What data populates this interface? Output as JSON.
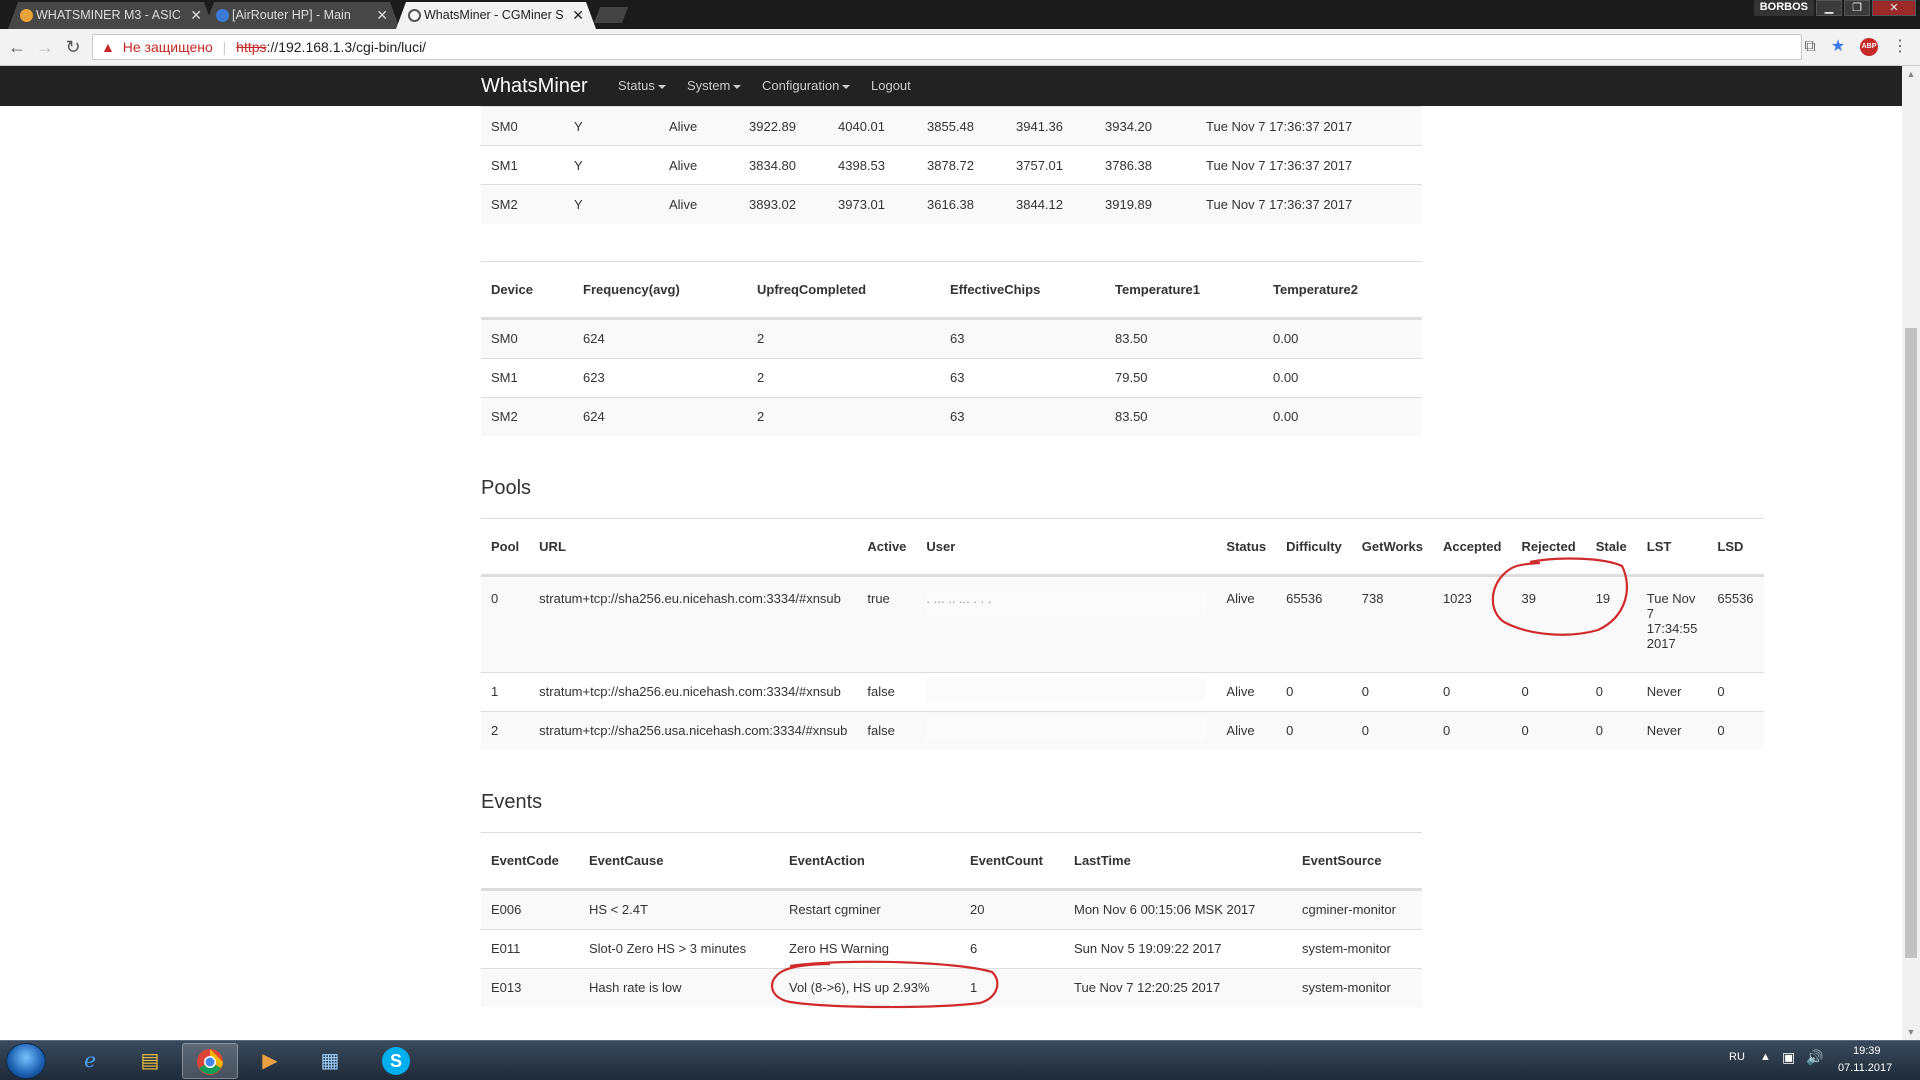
{
  "browser": {
    "tabs": [
      {
        "title": "WHATSMINER M3 - ASIC"
      },
      {
        "title": "[AirRouter HP] - Main"
      },
      {
        "title": "WhatsMiner - CGMiner S"
      }
    ],
    "profile_name": "BORBOS",
    "address": {
      "security_label": "Не защищено",
      "scheme": "https",
      "rest": "://192.168.1.3/cgi-bin/luci/"
    },
    "extension_abp": "ABP"
  },
  "site": {
    "brand": "WhatsMiner",
    "menu": {
      "status": "Status",
      "system": "System",
      "configuration": "Configuration",
      "logout": "Logout"
    }
  },
  "devices_table": {
    "rows": [
      [
        "SM0",
        "Y",
        "Alive",
        "3922.89",
        "4040.01",
        "3855.48",
        "3941.36",
        "3934.20",
        "Tue Nov 7 17:36:37 2017"
      ],
      [
        "SM1",
        "Y",
        "Alive",
        "3834.80",
        "4398.53",
        "3878.72",
        "3757.01",
        "3786.38",
        "Tue Nov 7 17:36:37 2017"
      ],
      [
        "SM2",
        "Y",
        "Alive",
        "3893.02",
        "3973.01",
        "3616.38",
        "3844.12",
        "3919.89",
        "Tue Nov 7 17:36:37 2017"
      ]
    ]
  },
  "freq_table": {
    "headers": [
      "Device",
      "Frequency(avg)",
      "UpfreqCompleted",
      "EffectiveChips",
      "Temperature1",
      "Temperature2"
    ],
    "rows": [
      [
        "SM0",
        "624",
        "2",
        "63",
        "83.50",
        "0.00"
      ],
      [
        "SM1",
        "623",
        "2",
        "63",
        "79.50",
        "0.00"
      ],
      [
        "SM2",
        "624",
        "2",
        "63",
        "83.50",
        "0.00"
      ]
    ]
  },
  "pools": {
    "title": "Pools",
    "headers": [
      "Pool",
      "URL",
      "Active",
      "User",
      "Status",
      "Difficulty",
      "GetWorks",
      "Accepted",
      "Rejected",
      "Stale",
      "LST",
      "LSD"
    ],
    "rows": [
      [
        "0",
        "stratum+tcp://sha256.eu.nicehash.com:3334/#xnsub",
        "true",
        ".    ...                      ..  ... . . .",
        "Alive",
        "65536",
        "738",
        "1023",
        "39",
        "19",
        "Tue Nov 7 17:34:55 2017",
        "65536"
      ],
      [
        "1",
        "stratum+tcp://sha256.eu.nicehash.com:3334/#xnsub",
        "false",
        "",
        "Alive",
        "0",
        "0",
        "0",
        "0",
        "0",
        "Never",
        "0"
      ],
      [
        "2",
        "stratum+tcp://sha256.usa.nicehash.com:3334/#xnsub",
        "false",
        "",
        "Alive",
        "0",
        "0",
        "0",
        "0",
        "0",
        "Never",
        "0"
      ]
    ]
  },
  "events": {
    "title": "Events",
    "headers": [
      "EventCode",
      "EventCause",
      "EventAction",
      "EventCount",
      "LastTime",
      "EventSource"
    ],
    "rows": [
      [
        "E006",
        "HS < 2.4T",
        "Restart cgminer",
        "20",
        "Mon Nov 6 00:15:06 MSK 2017",
        "cgminer-monitor"
      ],
      [
        "E011",
        "Slot-0 Zero HS > 3 minutes",
        "Zero HS Warning",
        "6",
        "Sun Nov 5 19:09:22 2017",
        "system-monitor"
      ],
      [
        "E013",
        "Hash rate is low",
        "Vol (8->6), HS up 2.93%",
        "1",
        "Tue Nov 7 12:20:25 2017",
        "system-monitor"
      ]
    ]
  },
  "taskbar": {
    "lang": "RU",
    "time": "19:39",
    "date": "07.11.2017"
  },
  "colors": {
    "annotation": "#d12a2a",
    "navbar": "#222222",
    "accent_star": "#3b78e7"
  }
}
